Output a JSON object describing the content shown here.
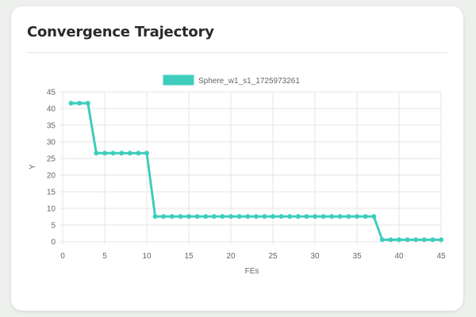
{
  "card": {
    "title": "Convergence Trajectory"
  },
  "colors": {
    "series": "#3ecdbd",
    "grid": "#e6e6e6"
  },
  "chart_data": {
    "type": "line",
    "title": "",
    "xlabel": "FEs",
    "ylabel": "Y",
    "xlim": [
      0,
      45
    ],
    "ylim": [
      0,
      45
    ],
    "x_ticks": [
      0,
      5,
      10,
      15,
      20,
      25,
      30,
      35,
      40,
      45
    ],
    "y_ticks": [
      0,
      5,
      10,
      15,
      20,
      25,
      30,
      35,
      40,
      45
    ],
    "grid": true,
    "legend_position": "top-center",
    "series": [
      {
        "name": "Sphere_w1_s1_1725973261",
        "x": [
          1,
          2,
          3,
          4,
          5,
          6,
          7,
          8,
          9,
          10,
          11,
          12,
          13,
          14,
          15,
          16,
          17,
          18,
          19,
          20,
          21,
          22,
          23,
          24,
          25,
          26,
          27,
          28,
          29,
          30,
          31,
          32,
          33,
          34,
          35,
          36,
          37,
          38,
          39,
          40,
          41,
          42,
          43,
          44,
          45
        ],
        "y": [
          41.6,
          41.6,
          41.6,
          26.6,
          26.6,
          26.6,
          26.6,
          26.6,
          26.6,
          26.6,
          7.6,
          7.6,
          7.6,
          7.6,
          7.6,
          7.6,
          7.6,
          7.6,
          7.6,
          7.6,
          7.6,
          7.6,
          7.6,
          7.6,
          7.6,
          7.6,
          7.6,
          7.6,
          7.6,
          7.6,
          7.6,
          7.6,
          7.6,
          7.6,
          7.6,
          7.6,
          7.6,
          0.6,
          0.6,
          0.6,
          0.6,
          0.6,
          0.6,
          0.6,
          0.6
        ]
      }
    ]
  }
}
